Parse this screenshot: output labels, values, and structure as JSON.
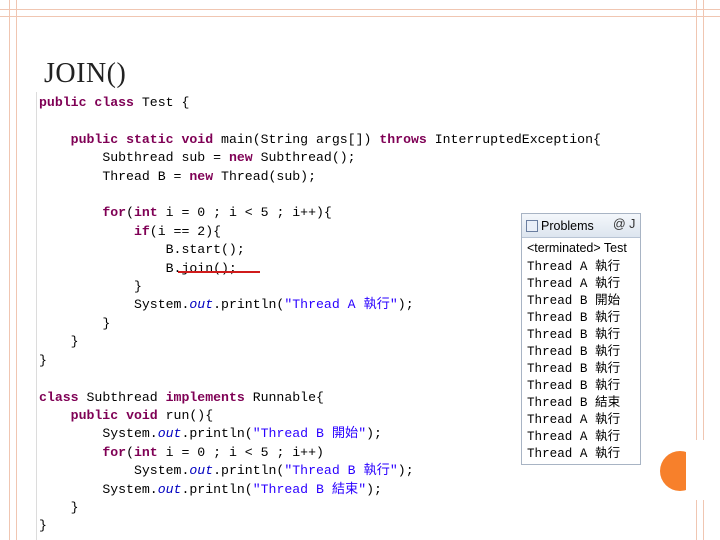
{
  "slide": {
    "title": "JOIN()"
  },
  "code": {
    "l1_kw1": "public",
    "l1_kw2": "class",
    "l1_rest": " Test {",
    "l3_kw1": "public",
    "l3_kw2": "static",
    "l3_kw3": "void",
    "l3_mid": " main(String args[]) ",
    "l3_kw4": "throws",
    "l3_rest": " InterruptedException{",
    "l4_a": "Subthread sub = ",
    "l4_kw": "new",
    "l4_b": " Subthread();",
    "l5_a": "Thread B = ",
    "l5_kw": "new",
    "l5_b": " Thread(sub);",
    "l7_kw1": "for",
    "l7_a": "(",
    "l7_kw2": "int",
    "l7_b": " i = 0 ; i < 5 ; i++){",
    "l8_kw": "if",
    "l8_b": "(i == 2){",
    "l9": "B.start();",
    "l10": "B.join();",
    "l11": "}",
    "l12_a": "System.",
    "l12_fld": "out",
    "l12_b": ".println(",
    "l12_str": "\"Thread A 執行\"",
    "l12_c": ");",
    "l13": "}",
    "l14": "}",
    "l15": "}",
    "l17_kw1": "class",
    "l17_a": " Subthread ",
    "l17_kw2": "implements",
    "l17_b": " Runnable{",
    "l18_kw1": "public",
    "l18_kw2": "void",
    "l18_b": " run(){",
    "l19_a": "System.",
    "l19_fld": "out",
    "l19_b": ".println(",
    "l19_str": "\"Thread B 開始\"",
    "l19_c": ");",
    "l20_kw1": "for",
    "l20_a": "(",
    "l20_kw2": "int",
    "l20_b": " i = 0 ; i < 5 ; i++)",
    "l21_a": "System.",
    "l21_fld": "out",
    "l21_b": ".println(",
    "l21_str": "\"Thread B 執行\"",
    "l21_c": ");",
    "l22_a": "System.",
    "l22_fld": "out",
    "l22_b": ".println(",
    "l22_str": "\"Thread B 結束\"",
    "l22_c": ");",
    "l23": "}",
    "l24": "}"
  },
  "console": {
    "tab_label": "Problems",
    "tab_next": "@ J",
    "status": "<terminated> Test",
    "lines": [
      "Thread A 執行",
      "Thread A 執行",
      "Thread B 開始",
      "Thread B 執行",
      "Thread B 執行",
      "Thread B 執行",
      "Thread B 執行",
      "Thread B 執行",
      "Thread B 結束",
      "Thread A 執行",
      "Thread A 執行",
      "Thread A 執行"
    ]
  },
  "colors": {
    "keyword": "#7f0055",
    "string": "#2a00ff",
    "field": "#0000c0",
    "frame": "#f0c6b2",
    "accent_circle": "#f7802b",
    "underline": "#d01b1b"
  }
}
